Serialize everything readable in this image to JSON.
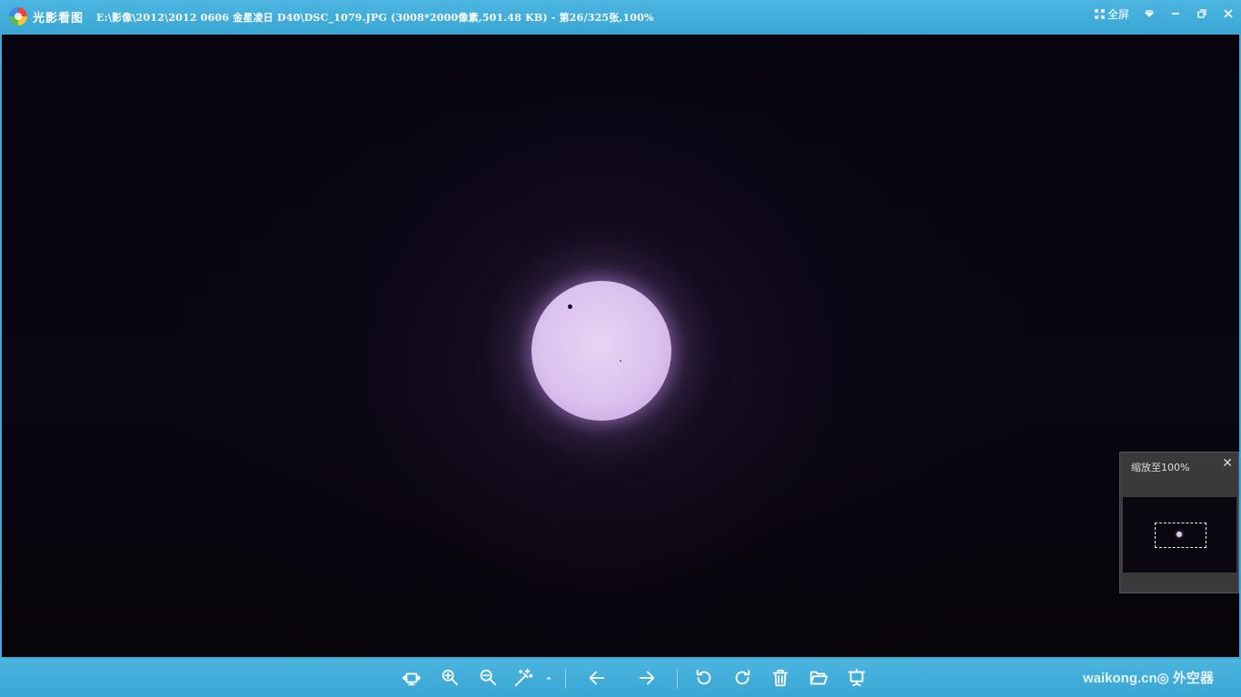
{
  "titlebar": {
    "app_name": "光影看图",
    "file_info": "E:\\影像\\2012\\2012 0606 金星凌日 D40\\DSC_1079.JPG (3008*2000像素,501.48 KB) - 第26/325张,100%",
    "fullscreen_label": "全屏",
    "icons": [
      "app-logo-icon",
      "fullscreen-icon",
      "menu-dropdown-icon",
      "minimize-icon",
      "restore-icon",
      "close-icon"
    ]
  },
  "navigator": {
    "title": "缩放至100%",
    "close_symbol": "✕"
  },
  "toolbar": {
    "icons": [
      "fit-screen-icon",
      "zoom-in-icon",
      "zoom-out-icon",
      "auto-enhance-icon",
      "more-arrow-icon",
      "prev-arrow-icon",
      "next-arrow-icon",
      "rotate-left-icon",
      "rotate-right-icon",
      "delete-icon",
      "open-folder-icon",
      "slideshow-icon"
    ]
  },
  "watermark": "waikong.cn◎ 外空器",
  "colors": {
    "chrome_blue": "#3fa9d6",
    "viewer_background": "#000000",
    "sun_color": "#dcc2ef"
  }
}
